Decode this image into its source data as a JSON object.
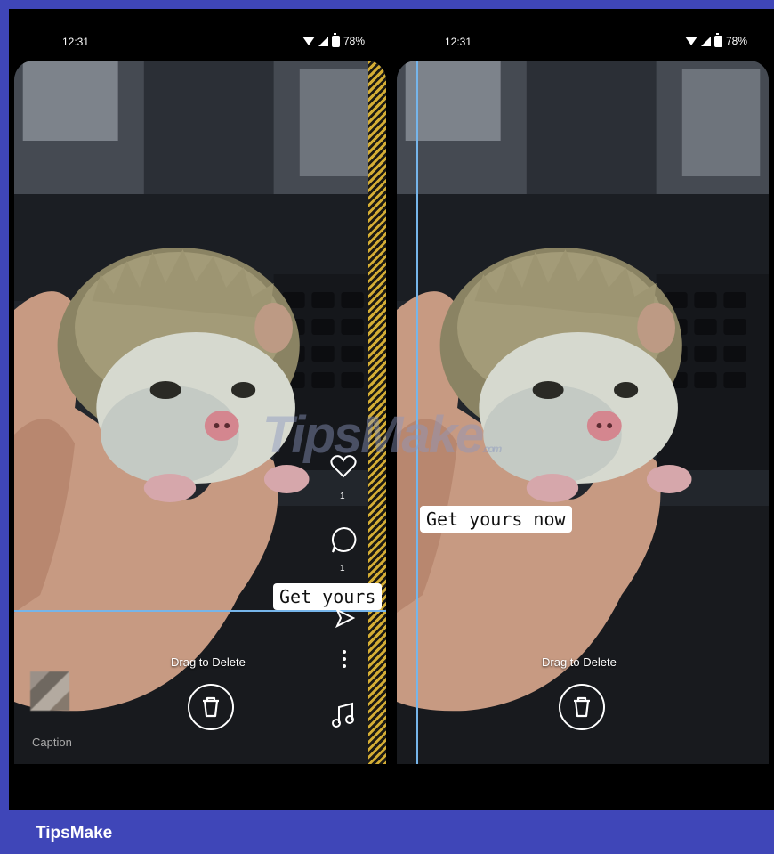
{
  "status_bar": {
    "time": "12:31",
    "battery": "78%"
  },
  "story_editor": {
    "drag_to_delete": "Drag to Delete",
    "text_sticker": "Get yours now",
    "text_sticker_partial": "Get yours",
    "caption_placeholder": "Caption",
    "likes_count": "1",
    "comments_count": "1"
  },
  "icons": [
    "wifi-icon",
    "signal-icon",
    "battery-icon",
    "trash-icon",
    "heart-icon",
    "comment-icon",
    "send-icon",
    "more-icon",
    "music-icon"
  ],
  "colors": {
    "frame_border": "#3f46b8",
    "guide_line": "#76b5ea",
    "stripe_yellow": "#d4ad34"
  },
  "branding": {
    "footer": "TipsMake",
    "watermark": "TipsMake",
    "watermark_suffix": ".com"
  }
}
